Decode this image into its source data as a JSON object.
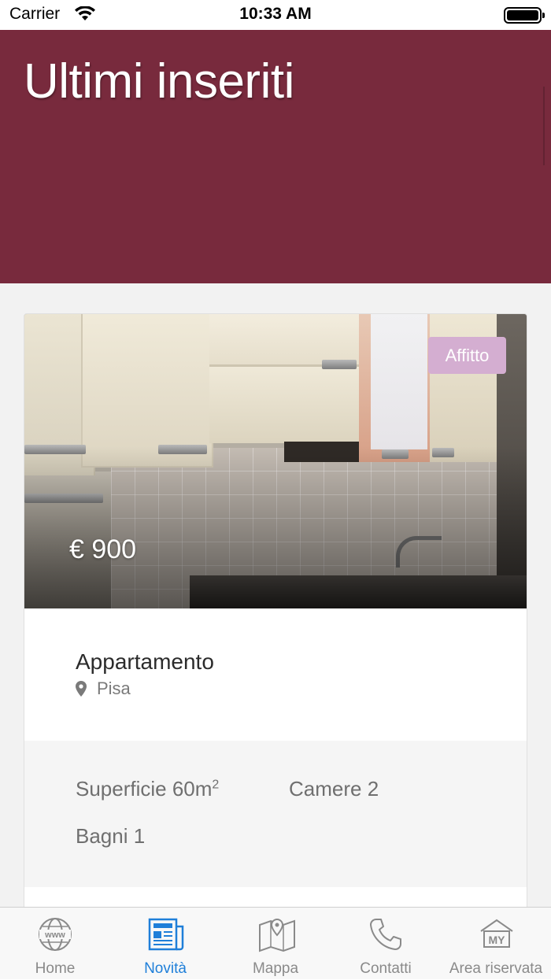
{
  "status_bar": {
    "carrier": "Carrier",
    "time": "10:33 AM"
  },
  "header": {
    "title": "Ultimi inseriti"
  },
  "listing": {
    "badge": "Affitto",
    "price": "€ 900",
    "type": "Appartamento",
    "location": "Pisa",
    "specs": {
      "surface_label": "Superficie 60m",
      "surface_sup": "2",
      "rooms": "Camere 2",
      "baths": "Bagni 1"
    }
  },
  "colors": {
    "header_bg": "#782a3d",
    "badge_bg": "#d4aed1",
    "active_tab": "#1f7fd9"
  },
  "tabbar": {
    "active": "Novità",
    "tabs": [
      {
        "label": "Home",
        "icon": "globe-www-icon"
      },
      {
        "label": "Novità",
        "icon": "newspaper-icon"
      },
      {
        "label": "Mappa",
        "icon": "map-icon"
      },
      {
        "label": "Contatti",
        "icon": "phone-icon"
      },
      {
        "label": "Area riservata",
        "icon": "my-area-icon"
      }
    ]
  }
}
